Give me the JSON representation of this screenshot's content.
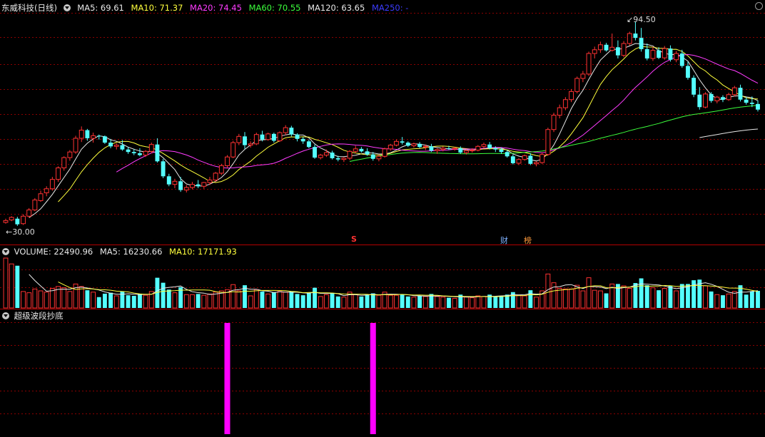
{
  "main_header": {
    "title": "东威科技(日线)",
    "ma": [
      {
        "label": "MA5: 69.61",
        "color": "#e8e8e8"
      },
      {
        "label": "MA10: 71.37",
        "color": "#ffff3c"
      },
      {
        "label": "MA20: 74.45",
        "color": "#ff3cff"
      },
      {
        "label": "MA60: 70.55",
        "color": "#3cff3c"
      },
      {
        "label": "MA120: 63.65",
        "color": "#e8e8e8"
      },
      {
        "label": "MA250: -",
        "color": "#3c3cff"
      }
    ]
  },
  "volume_header": {
    "items": [
      {
        "label": "VOLUME: 22490.96",
        "color": "#e8e8e8"
      },
      {
        "label": "MA5: 16230.66",
        "color": "#e8e8e8"
      },
      {
        "label": "MA10: 17171.93",
        "color": "#ffff3c"
      }
    ]
  },
  "indicator_header": {
    "title": "超级波段抄底"
  },
  "annotations": {
    "high_label": "94.50",
    "low_label": "←30.00",
    "event_s": "S",
    "event_cai": "财",
    "event_bang": "榜"
  },
  "colors": {
    "up": "#ff3232",
    "down": "#54ffff",
    "grid": "#8c0000",
    "ma5": "#e8e8e8",
    "ma10": "#ffff3c",
    "ma20": "#ff3cff",
    "ma60": "#3cff3c",
    "signal": "#ff00ff"
  },
  "chart_data": {
    "type": "candlestick",
    "price_range": [
      30.0,
      94.5
    ],
    "candles_ohlc": [
      [
        30.0,
        31.2,
        29.6,
        30.6
      ],
      [
        30.8,
        32.0,
        30.4,
        31.6
      ],
      [
        31.2,
        31.8,
        28.9,
        29.4
      ],
      [
        29.6,
        32.6,
        29.2,
        32.0
      ],
      [
        32.0,
        34.6,
        31.6,
        34.0
      ],
      [
        34.0,
        37.8,
        33.6,
        37.2
      ],
      [
        37.0,
        40.2,
        36.6,
        39.2
      ],
      [
        39.5,
        41.6,
        38.4,
        40.8
      ],
      [
        40.8,
        44.6,
        40.2,
        43.8
      ],
      [
        43.8,
        48.0,
        43.0,
        47.5
      ],
      [
        47.5,
        51.2,
        46.6,
        50.8
      ],
      [
        50.8,
        53.2,
        49.8,
        52.6
      ],
      [
        52.6,
        57.8,
        52.0,
        57.0
      ],
      [
        57.0,
        60.8,
        55.8,
        59.6
      ],
      [
        59.6,
        60.0,
        56.2,
        57.0
      ],
      [
        57.0,
        58.8,
        55.6,
        57.8
      ],
      [
        57.8,
        58.2,
        56.6,
        57.6
      ],
      [
        57.6,
        57.9,
        55.2,
        55.6
      ],
      [
        55.6,
        56.8,
        53.8,
        54.4
      ],
      [
        54.4,
        55.4,
        53.4,
        54.8
      ],
      [
        54.8,
        56.4,
        53.0,
        53.4
      ],
      [
        53.4,
        54.2,
        52.0,
        52.6
      ],
      [
        52.6,
        53.6,
        51.6,
        52.2
      ],
      [
        52.2,
        53.8,
        51.2,
        51.6
      ],
      [
        51.6,
        53.2,
        51.0,
        52.8
      ],
      [
        52.8,
        55.6,
        52.2,
        55.0
      ],
      [
        55.0,
        57.0,
        49.2,
        49.6
      ],
      [
        49.6,
        50.4,
        44.2,
        44.8
      ],
      [
        44.8,
        45.6,
        41.6,
        42.2
      ],
      [
        42.2,
        44.0,
        41.0,
        43.2
      ],
      [
        43.2,
        44.6,
        39.8,
        40.4
      ],
      [
        40.4,
        42.0,
        39.6,
        41.2
      ],
      [
        41.2,
        43.0,
        40.6,
        42.2
      ],
      [
        42.2,
        43.6,
        41.0,
        41.6
      ],
      [
        41.6,
        43.0,
        40.8,
        42.8
      ],
      [
        42.8,
        44.6,
        42.0,
        43.6
      ],
      [
        43.6,
        46.2,
        43.0,
        45.8
      ],
      [
        45.8,
        48.8,
        45.2,
        48.2
      ],
      [
        48.2,
        51.6,
        47.6,
        51.0
      ],
      [
        51.0,
        56.2,
        50.6,
        55.6
      ],
      [
        55.6,
        58.4,
        54.8,
        57.6
      ],
      [
        57.6,
        59.0,
        53.6,
        54.8
      ],
      [
        54.8,
        56.0,
        54.0,
        55.2
      ],
      [
        55.2,
        58.8,
        54.8,
        58.2
      ],
      [
        58.2,
        59.4,
        56.0,
        56.6
      ],
      [
        56.6,
        58.8,
        56.2,
        58.4
      ],
      [
        58.4,
        58.8,
        55.6,
        56.2
      ],
      [
        56.2,
        59.2,
        55.8,
        58.8
      ],
      [
        58.8,
        61.2,
        58.0,
        60.4
      ],
      [
        60.4,
        61.0,
        57.6,
        58.2
      ],
      [
        58.2,
        58.6,
        56.0,
        56.8
      ],
      [
        56.8,
        57.4,
        55.2,
        56.0
      ],
      [
        56.0,
        56.6,
        53.8,
        54.2
      ],
      [
        54.2,
        55.0,
        50.4,
        50.8
      ],
      [
        50.8,
        52.0,
        50.2,
        51.6
      ],
      [
        51.6,
        53.4,
        51.0,
        52.4
      ],
      [
        52.4,
        53.0,
        50.2,
        50.6
      ],
      [
        50.6,
        51.4,
        49.6,
        50.2
      ],
      [
        50.2,
        51.0,
        49.4,
        50.6
      ],
      [
        50.6,
        53.2,
        50.0,
        52.8
      ],
      [
        52.8,
        54.6,
        52.2,
        53.6
      ],
      [
        53.6,
        54.2,
        52.4,
        52.8
      ],
      [
        52.8,
        53.8,
        51.4,
        51.8
      ],
      [
        51.8,
        52.6,
        49.8,
        50.4
      ],
      [
        50.4,
        51.8,
        49.6,
        51.2
      ],
      [
        51.2,
        54.0,
        50.8,
        53.6
      ],
      [
        53.6,
        55.2,
        53.0,
        54.8
      ],
      [
        54.8,
        56.6,
        54.4,
        56.0
      ],
      [
        56.0,
        57.4,
        55.0,
        55.6
      ],
      [
        55.6,
        56.0,
        54.2,
        54.6
      ],
      [
        54.6,
        55.6,
        54.0,
        55.2
      ],
      [
        55.2,
        55.8,
        53.8,
        54.2
      ],
      [
        54.2,
        55.0,
        53.2,
        54.4
      ],
      [
        54.4,
        55.2,
        52.6,
        53.0
      ],
      [
        53.0,
        53.8,
        52.0,
        53.4
      ],
      [
        53.4,
        54.4,
        52.8,
        53.8
      ],
      [
        53.8,
        54.6,
        53.2,
        53.6
      ],
      [
        53.6,
        54.2,
        53.0,
        53.8
      ],
      [
        53.8,
        54.4,
        52.0,
        52.4
      ],
      [
        52.4,
        53.4,
        51.8,
        53.0
      ],
      [
        53.0,
        53.8,
        52.4,
        53.2
      ],
      [
        53.2,
        54.8,
        52.8,
        54.4
      ],
      [
        54.4,
        55.6,
        53.8,
        55.0
      ],
      [
        55.0,
        55.8,
        53.4,
        53.8
      ],
      [
        53.8,
        54.4,
        52.6,
        53.4
      ],
      [
        53.4,
        54.0,
        52.0,
        52.6
      ],
      [
        52.6,
        53.2,
        50.8,
        51.2
      ],
      [
        51.2,
        51.8,
        48.6,
        49.0
      ],
      [
        49.0,
        50.6,
        48.4,
        50.2
      ],
      [
        50.2,
        51.8,
        49.8,
        51.4
      ],
      [
        51.4,
        52.2,
        48.4,
        48.8
      ],
      [
        48.8,
        49.6,
        48.0,
        49.2
      ],
      [
        49.2,
        52.4,
        48.8,
        51.8
      ],
      [
        51.8,
        60.4,
        51.4,
        59.8
      ],
      [
        59.8,
        65.2,
        59.0,
        64.4
      ],
      [
        64.4,
        67.8,
        63.4,
        66.8
      ],
      [
        66.8,
        70.2,
        66.0,
        69.4
      ],
      [
        69.4,
        72.8,
        68.6,
        72.0
      ],
      [
        72.0,
        76.8,
        71.4,
        76.2
      ],
      [
        76.2,
        78.6,
        75.0,
        77.6
      ],
      [
        77.6,
        84.8,
        77.0,
        84.2
      ],
      [
        84.2,
        86.4,
        82.6,
        85.4
      ],
      [
        85.4,
        88.0,
        84.4,
        87.0
      ],
      [
        87.0,
        87.6,
        84.8,
        85.2
      ],
      [
        85.2,
        90.6,
        84.8,
        86.2
      ],
      [
        86.2,
        88.4,
        82.6,
        83.6
      ],
      [
        83.6,
        88.2,
        83.0,
        87.4
      ],
      [
        87.4,
        91.2,
        86.8,
        90.6
      ],
      [
        90.6,
        94.5,
        88.4,
        89.2
      ],
      [
        89.2,
        92.4,
        84.8,
        85.6
      ],
      [
        85.6,
        87.4,
        82.0,
        82.6
      ],
      [
        82.6,
        86.4,
        81.8,
        85.2
      ],
      [
        85.2,
        86.2,
        82.4,
        82.8
      ],
      [
        82.8,
        86.6,
        82.2,
        85.8
      ],
      [
        85.8,
        86.8,
        81.6,
        82.2
      ],
      [
        82.2,
        85.0,
        81.4,
        84.2
      ],
      [
        84.2,
        85.4,
        79.6,
        80.2
      ],
      [
        80.2,
        81.6,
        75.8,
        76.4
      ],
      [
        76.4,
        77.2,
        70.2,
        71.0
      ],
      [
        71.0,
        73.4,
        66.2,
        67.0
      ],
      [
        67.0,
        71.8,
        66.6,
        71.2
      ],
      [
        71.2,
        71.8,
        68.4,
        69.0
      ],
      [
        69.0,
        70.6,
        68.2,
        70.2
      ],
      [
        70.2,
        70.8,
        68.6,
        69.4
      ],
      [
        69.4,
        71.6,
        69.0,
        71.0
      ],
      [
        71.0,
        73.8,
        70.4,
        73.2
      ],
      [
        73.2,
        74.2,
        68.8,
        69.4
      ],
      [
        69.4,
        70.2,
        67.8,
        68.4
      ],
      [
        68.4,
        70.4,
        67.0,
        68.0
      ],
      [
        68.0,
        69.2,
        65.6,
        66.2
      ]
    ],
    "signal_bar_indices": [
      38,
      63
    ],
    "event_marker_indices": {
      "S": 62,
      "财": 90,
      "榜": 94
    }
  }
}
